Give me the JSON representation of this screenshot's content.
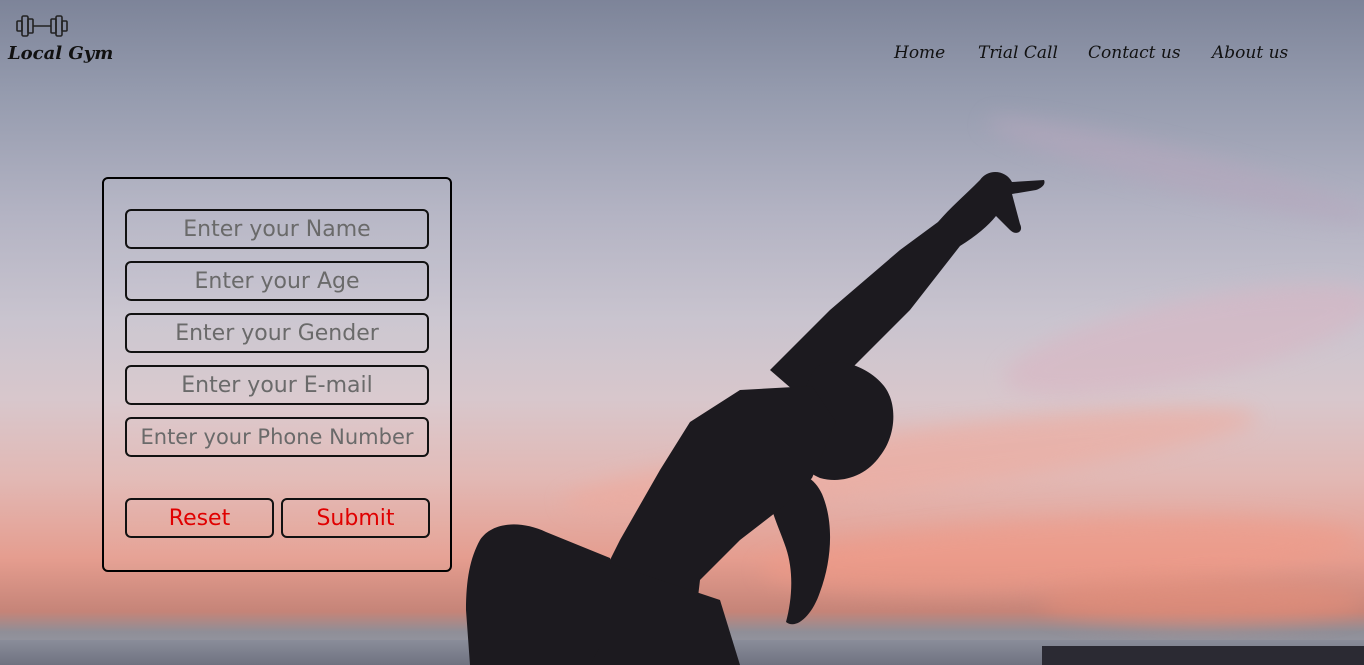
{
  "brand": {
    "name": "Local Gym",
    "icon": "dumbbell-icon"
  },
  "nav": {
    "items": [
      "Home",
      "Trial Call",
      "Contact us",
      "About us"
    ]
  },
  "form": {
    "name_placeholder": "Enter your Name",
    "age_placeholder": "Enter your Age",
    "gender_placeholder": "Enter your Gender",
    "email_placeholder": "Enter your E-mail",
    "phone_placeholder": "Enter your Phone Number",
    "reset_label": "Reset",
    "submit_label": "Submit"
  },
  "colors": {
    "button_text": "#e00000",
    "border": "#111111"
  }
}
